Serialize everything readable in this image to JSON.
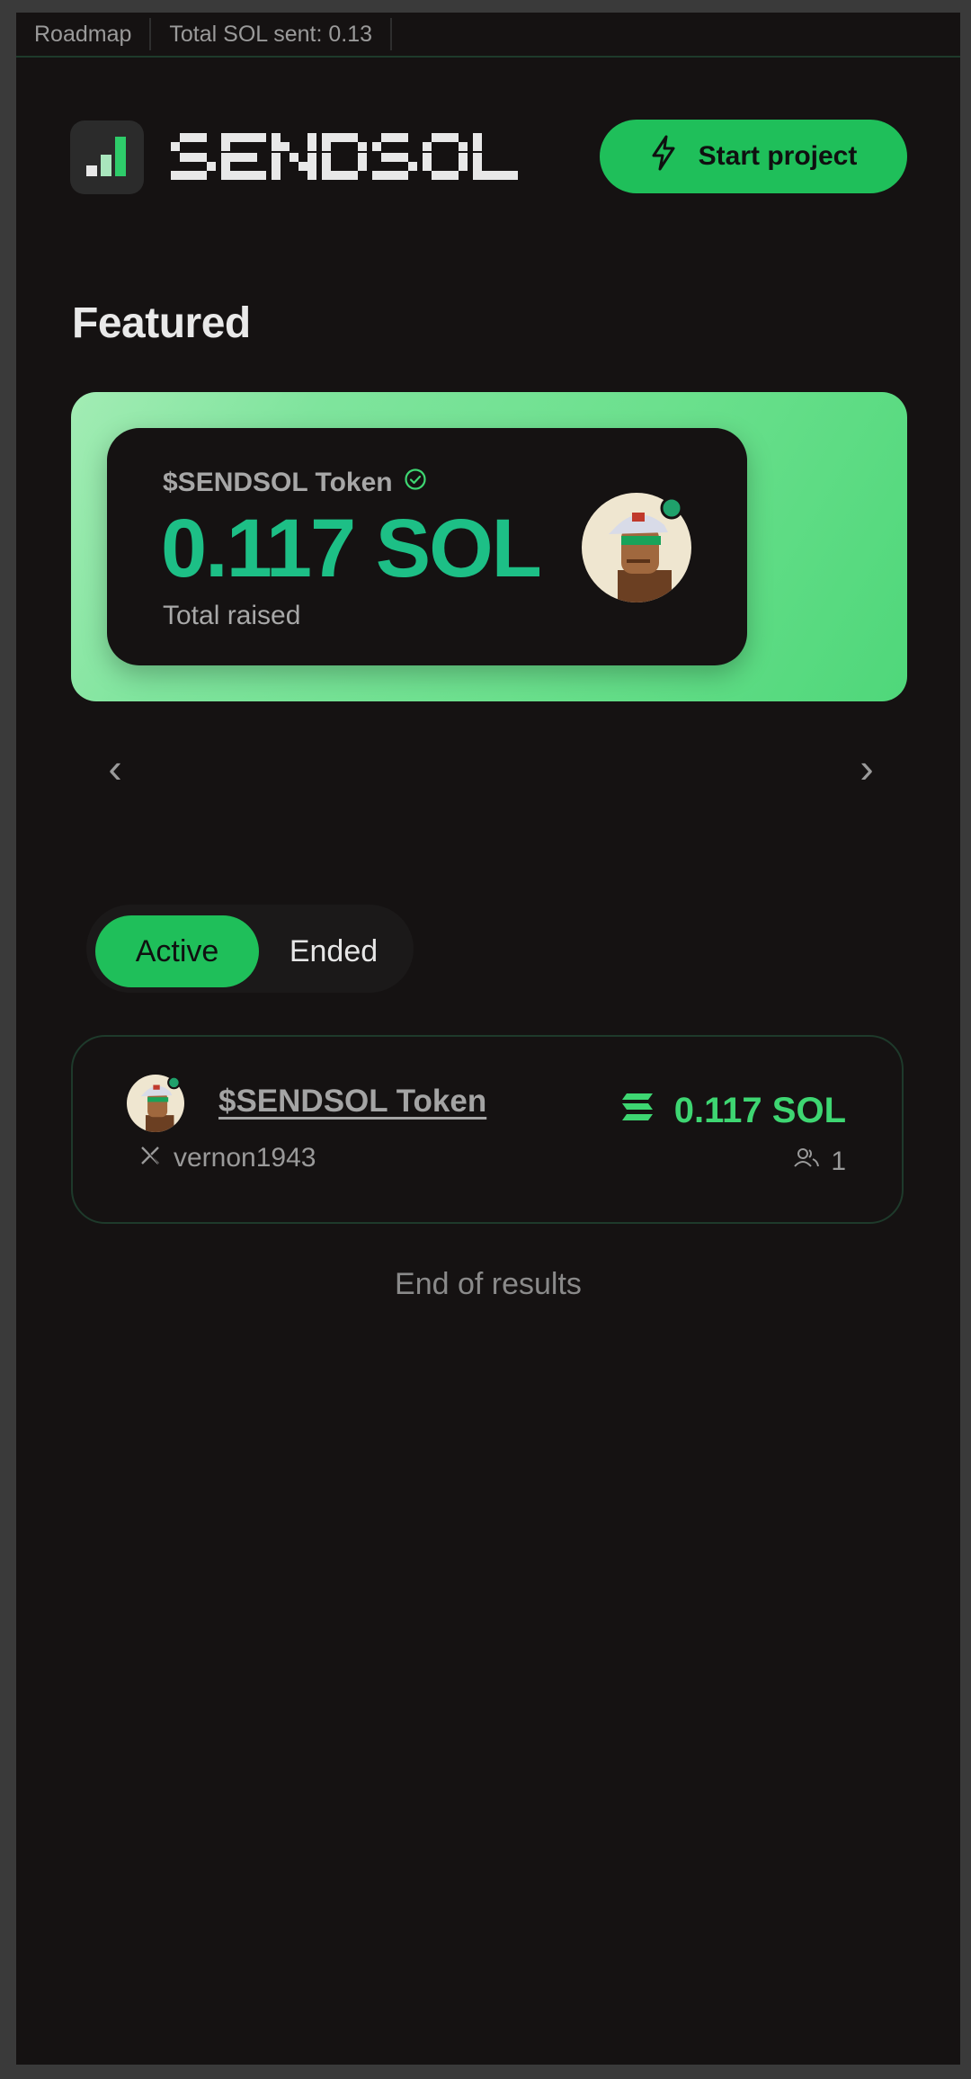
{
  "topbar": {
    "roadmap": "Roadmap",
    "total_sent": "Total SOL sent: 0.13"
  },
  "header": {
    "logo_text": "SENDSOL",
    "start_button": "Start project"
  },
  "featured": {
    "title": "Featured",
    "card": {
      "name": "$SENDSOL Token",
      "amount": "0.117 SOL",
      "label": "Total raised"
    },
    "prev": "‹",
    "next": "›"
  },
  "tabs": {
    "active": "Active",
    "ended": "Ended"
  },
  "projects": [
    {
      "name": "$SENDSOL Token",
      "handle": "vernon1943",
      "amount": "0.117 SOL",
      "backers": "1"
    }
  ],
  "footer": {
    "end_text": "End of results"
  },
  "colors": {
    "accent": "#1fbf5a",
    "amount_teal": "#1dbf86",
    "background": "#151212"
  }
}
